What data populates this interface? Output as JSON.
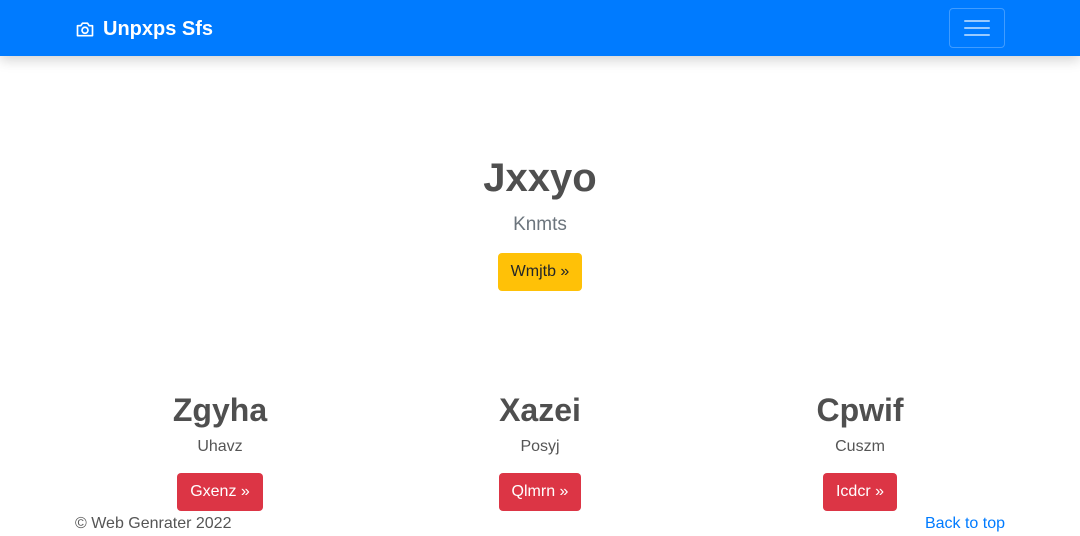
{
  "navbar": {
    "brand_icon": "camera-icon",
    "brand_text": "Unpxps Sfs",
    "toggler_icon": "hamburger-menu-icon",
    "background": "#007bff"
  },
  "hero": {
    "title": "Jxxyo",
    "subtitle": "Knmts",
    "button_label": "Wmjtb »",
    "button_color": "#ffc107"
  },
  "columns": [
    {
      "title": "Zgyha",
      "text": "Uhavz",
      "button_label": "Gxenz »"
    },
    {
      "title": "Xazei",
      "text": "Posyj",
      "button_label": "Qlmrn »"
    },
    {
      "title": "Cpwif",
      "text": "Cuszm",
      "button_label": "Icdcr »"
    }
  ],
  "column_button_color": "#dc3545",
  "footer": {
    "copyright": "© Web Genrater 2022",
    "back_to_top": "Back to top"
  }
}
